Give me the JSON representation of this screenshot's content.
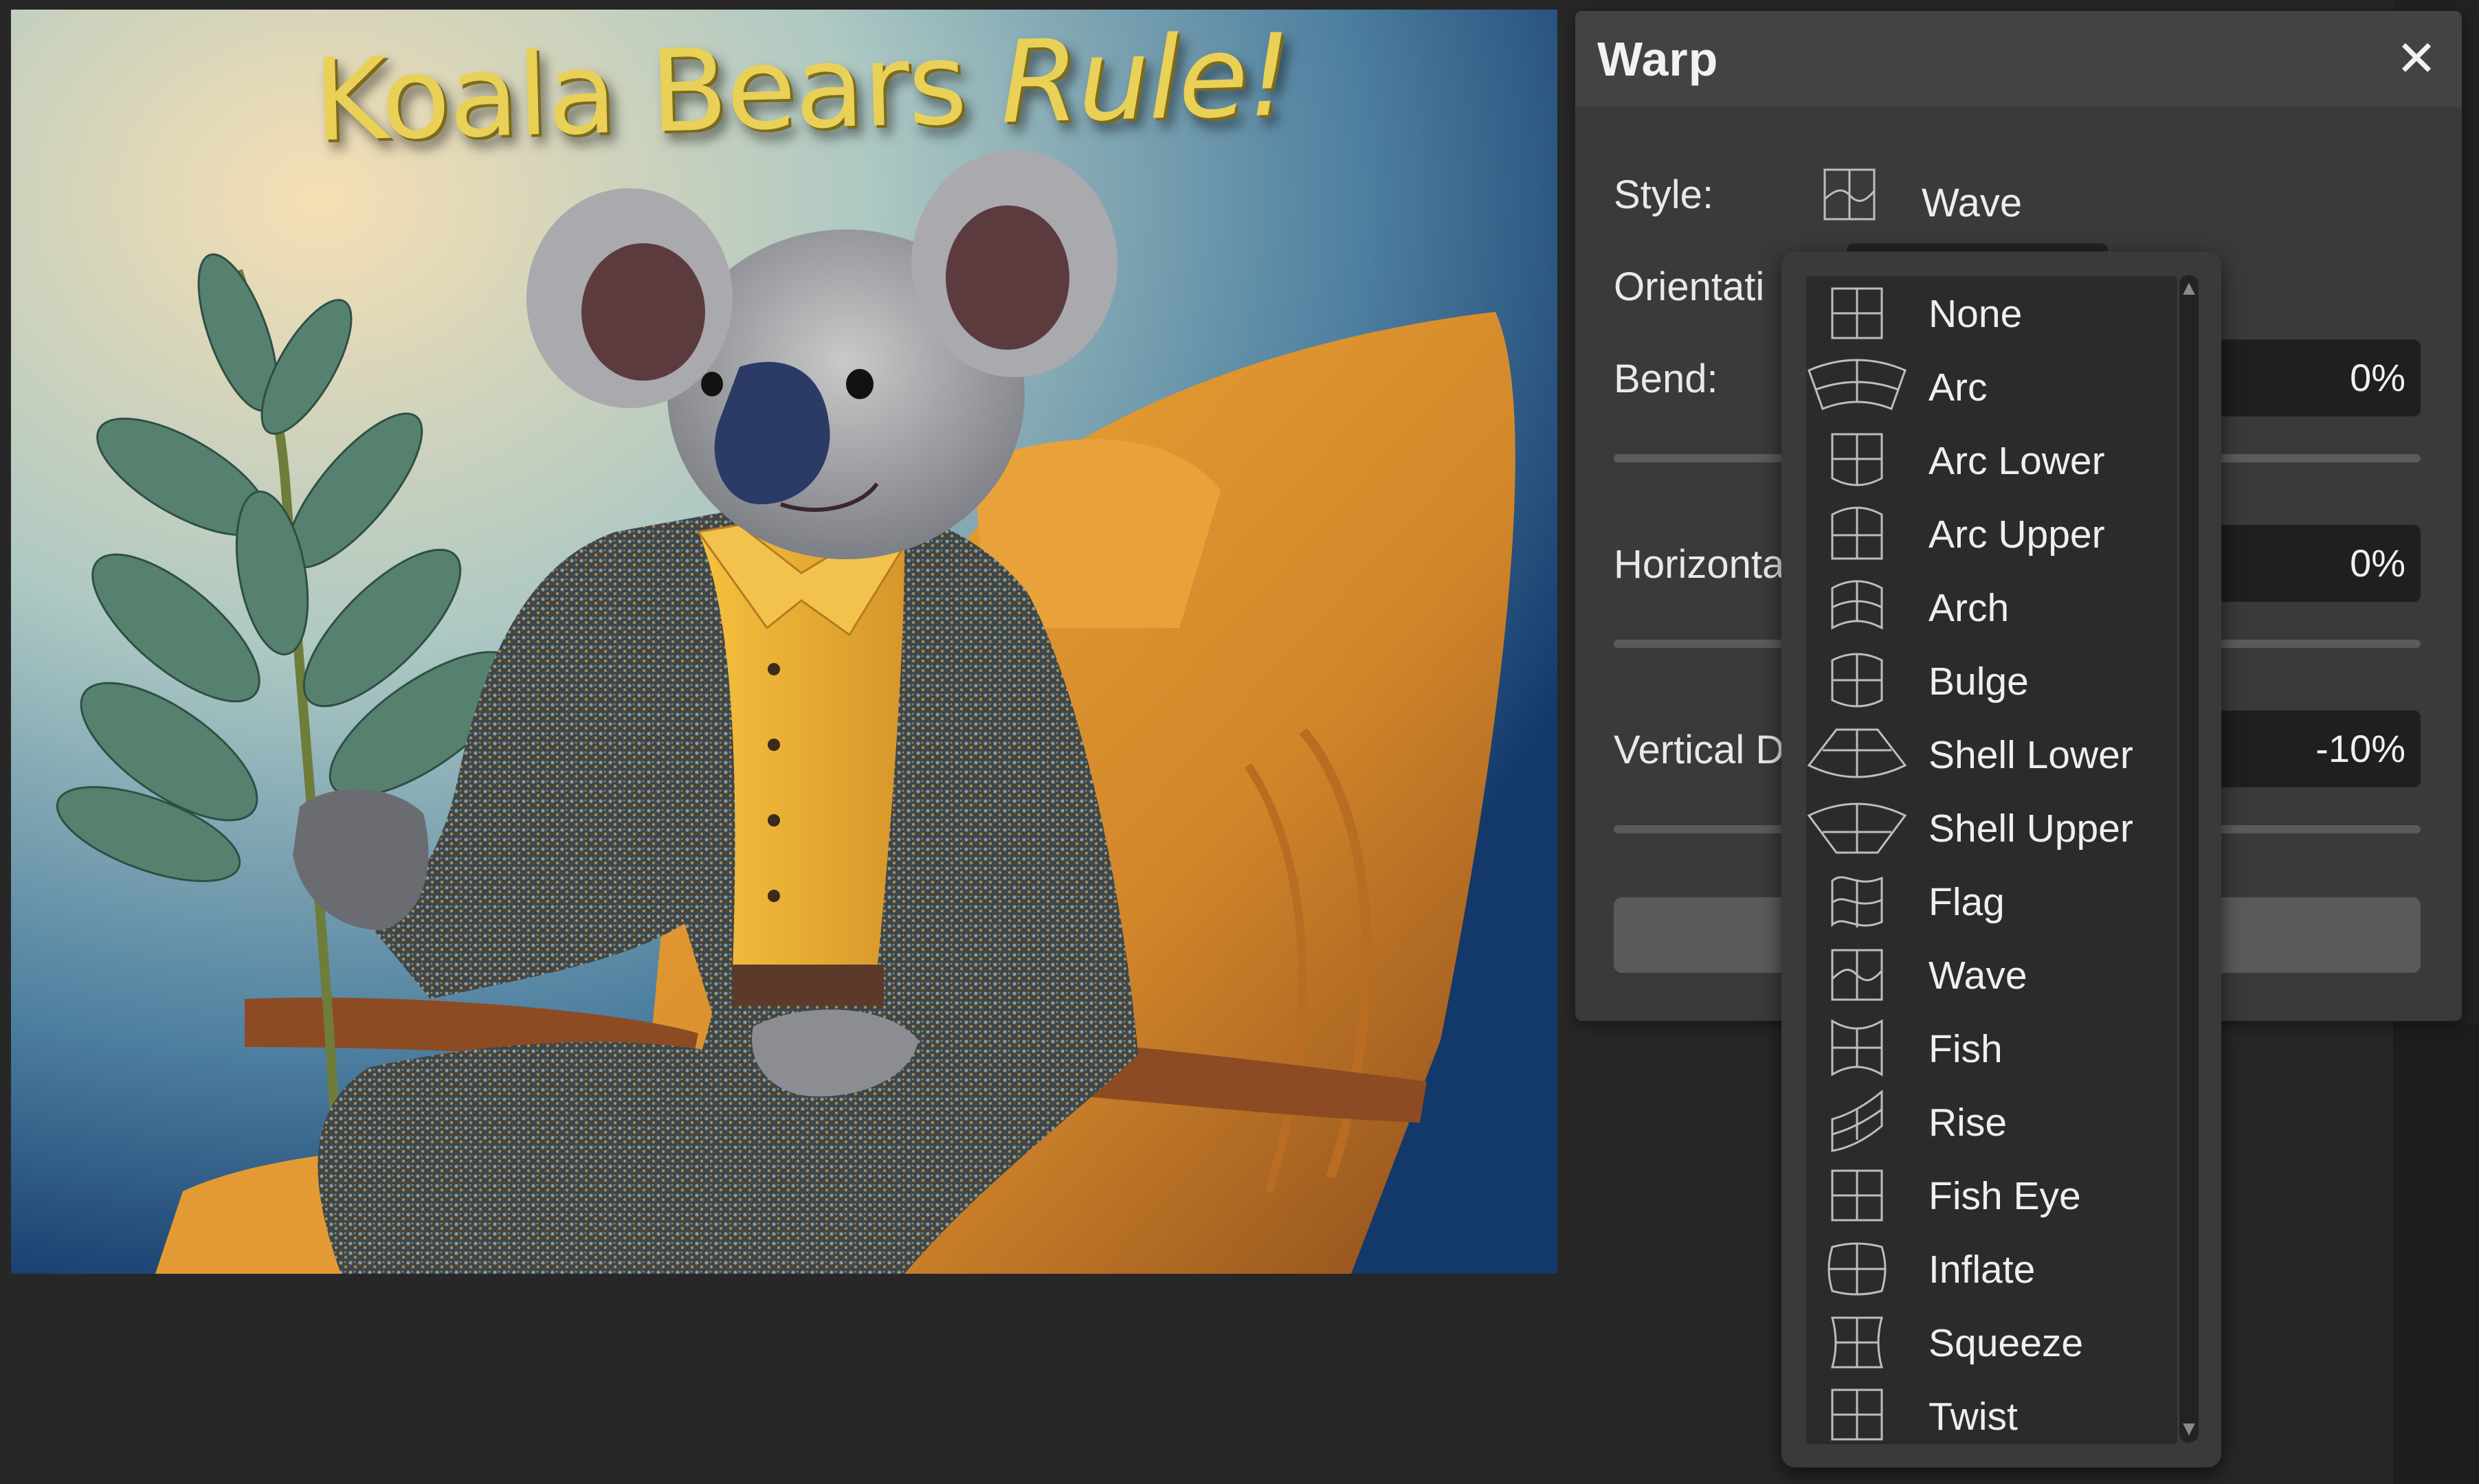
{
  "artwork": {
    "title_part1": "Koala Bears ",
    "title_part2": "Rule!"
  },
  "panel": {
    "title": "Warp",
    "close_glyph": "✕",
    "style_label": "Style:",
    "style_value": "Wave",
    "orientation_label": "Orientati",
    "bend_label": "Bend:",
    "bend_value": "0%",
    "horizontal_label": "Horizonta",
    "horizontal_value": "0%",
    "vertical_label": "Vertical D",
    "vertical_value": "-10%"
  },
  "dropdown": {
    "selected": "Wave",
    "scroll_up_glyph": "▲",
    "scroll_down_glyph": "▼",
    "items": [
      {
        "label": "None",
        "icon": "warp-none-icon"
      },
      {
        "label": "Arc",
        "icon": "warp-arc-icon"
      },
      {
        "label": "Arc Lower",
        "icon": "warp-arc-lower-icon"
      },
      {
        "label": "Arc Upper",
        "icon": "warp-arc-upper-icon"
      },
      {
        "label": "Arch",
        "icon": "warp-arch-icon"
      },
      {
        "label": "Bulge",
        "icon": "warp-bulge-icon"
      },
      {
        "label": "Shell Lower",
        "icon": "warp-shell-lower-icon"
      },
      {
        "label": "Shell Upper",
        "icon": "warp-shell-upper-icon"
      },
      {
        "label": "Flag",
        "icon": "warp-flag-icon"
      },
      {
        "label": "Wave",
        "icon": "warp-wave-icon"
      },
      {
        "label": "Fish",
        "icon": "warp-fish-icon"
      },
      {
        "label": "Rise",
        "icon": "warp-rise-icon"
      },
      {
        "label": "Fish Eye",
        "icon": "warp-fish-eye-icon"
      },
      {
        "label": "Inflate",
        "icon": "warp-inflate-icon"
      },
      {
        "label": "Squeeze",
        "icon": "warp-squeeze-icon"
      },
      {
        "label": "Twist",
        "icon": "warp-twist-icon"
      }
    ]
  },
  "colors": {
    "panel_bg": "#3a3a3a",
    "field_bg": "#1f1f1f",
    "title_text": "#e9d157",
    "chair": "#e0982e"
  }
}
